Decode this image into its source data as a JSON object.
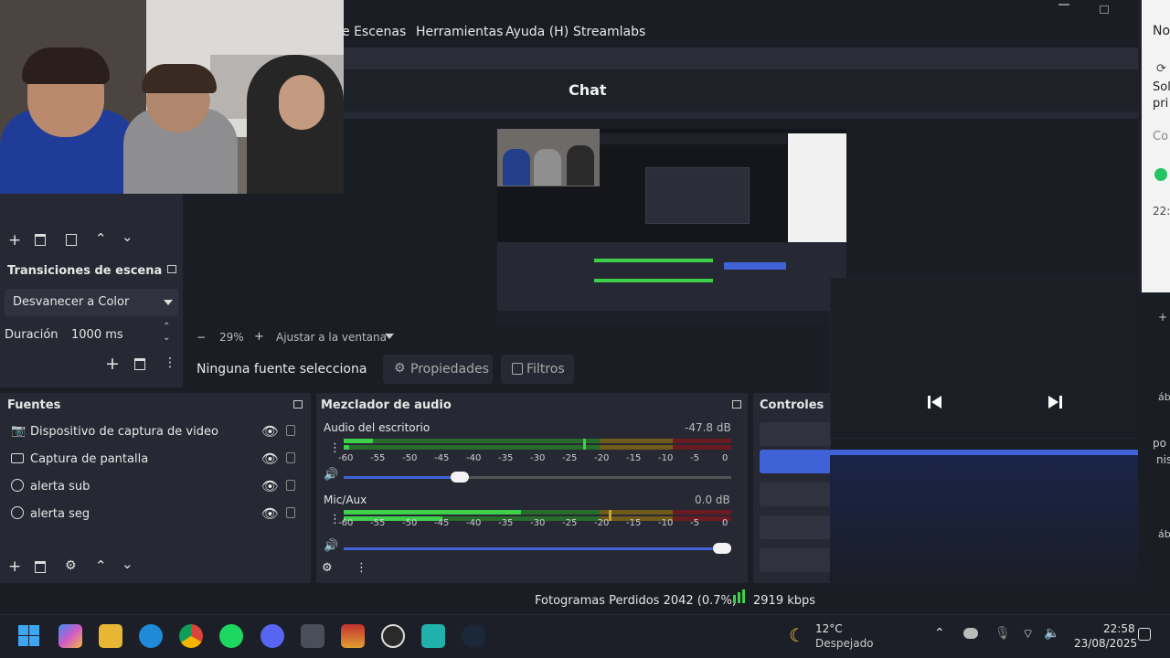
{
  "menu": {
    "escenas": "e Escenas",
    "herramientas": "Herramientas",
    "ayuda": "Ayuda (H)",
    "streamlabs": "Streamlabs"
  },
  "chat_dock": {
    "title": "Chat"
  },
  "preview_bar": {
    "zoom_minus": "−",
    "zoom": "29%",
    "zoom_plus": "+",
    "fit": "Ajustar a la ventana"
  },
  "source_toolbar": {
    "status": "Ninguna fuente selecciona",
    "properties": "Propiedades",
    "filters": "Filtros"
  },
  "transitions": {
    "title": "Transiciones de escena",
    "selected": "Desvanecer a Color",
    "duration_label": "Duración",
    "duration_value": "1000 ms"
  },
  "sources": {
    "title": "Fuentes",
    "items": [
      {
        "label": "Dispositivo de captura de video",
        "icon": "camera-icon"
      },
      {
        "label": "Captura de pantalla",
        "icon": "monitor-icon"
      },
      {
        "label": "alerta sub",
        "icon": "globe-icon"
      },
      {
        "label": "alerta seg",
        "icon": "globe-icon"
      }
    ]
  },
  "mixer": {
    "title": "Mezclador de audio",
    "channels": [
      {
        "name": "Audio del escritorio",
        "db": "-47.8 dB",
        "volume": 0.3
      },
      {
        "name": "Mic/Aux",
        "db": "0.0 dB",
        "volume": 1.0
      }
    ],
    "ticks": [
      "-60",
      "-55",
      "-50",
      "-45",
      "-40",
      "-35",
      "-30",
      "-25",
      "-20",
      "-15",
      "-10",
      "-5",
      "0"
    ]
  },
  "controls": {
    "title": "Controles"
  },
  "status_bar": {
    "dropped": "Fotogramas Perdidos 2042 (0.7%)",
    "bitrate": "2919 kbps"
  },
  "notification": {
    "title": "No",
    "line1": "Sol",
    "line2": "pri",
    "link": "Co",
    "time": "22:"
  },
  "right_edge": {
    "t1": "áb",
    "t2": "po",
    "t3": "nis",
    "t4": "áb"
  },
  "taskbar": {
    "temp": "12°C",
    "weather": "Despejado",
    "time": "22:58",
    "date": "23/08/2025"
  },
  "colors": {
    "accent": "#3f62d6",
    "meter_green": "#3ecf4b",
    "meter_yellow": "#c9a227",
    "meter_red": "#b8262f"
  }
}
